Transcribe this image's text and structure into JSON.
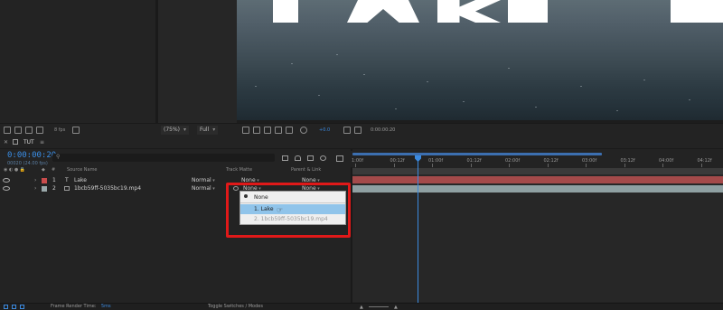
{
  "viewer": {
    "fps": "8 fps",
    "zoom": "(75%)",
    "resolution": "Full",
    "exposure": "+0.0",
    "current_time": "0:00:00:20"
  },
  "timeline": {
    "tab_title": "TUT",
    "timecode": "0:00:00:20",
    "sub_timecode": "00020 (24.00 fps)",
    "search_placeholder": "",
    "columns": {
      "source_name": "Source Name",
      "track_matte": "Track Matte",
      "parent_link": "Parent & Link"
    },
    "layers": [
      {
        "index": "1",
        "type_icon": "T",
        "name": "Lake",
        "mode": "Normal",
        "matte": "None",
        "parent": "None",
        "color": "#c94c4c"
      },
      {
        "index": "2",
        "type_icon": "",
        "name": "1bcb59ff-5035bc19.mp4",
        "mode": "Normal",
        "matte": "None",
        "parent": "None",
        "color": "#9aa8aa"
      }
    ],
    "ruler_ticks": [
      "1:00f",
      "00:12f",
      "01:00f",
      "01:12f",
      "02:00f",
      "02:12f",
      "03:00f",
      "03:12f",
      "04:00f",
      "04:12f"
    ]
  },
  "matte_popup": {
    "items": [
      "None",
      "1. Lake",
      "2. 1bcb59ff-5035bc19.mp4"
    ]
  },
  "bottom_bar": {
    "render_label": "Frame Render Time:",
    "render_value": "5ms",
    "toggle_label": "Toggle Switches / Modes"
  },
  "colors": {
    "accent_blue": "#3b8ae0",
    "highlight_red": "#e01919",
    "layer1_track": "#a44a4a",
    "layer2_track": "#8fa0a2"
  }
}
